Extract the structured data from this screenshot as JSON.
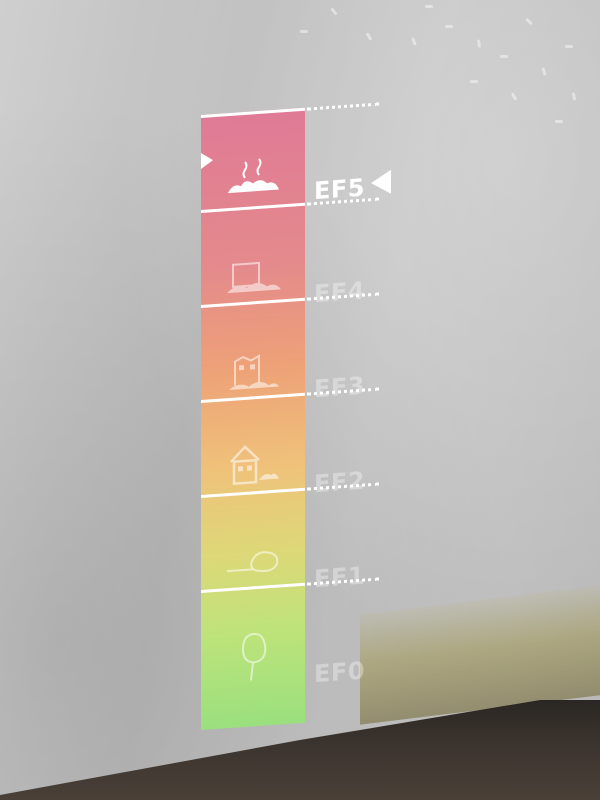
{
  "scale": {
    "levels": [
      {
        "label": "EF5",
        "icon": "destroyed-rubble-icon",
        "active": true
      },
      {
        "label": "EF4",
        "icon": "collapsed-house-icon",
        "active": false
      },
      {
        "label": "EF3",
        "icon": "damaged-house-icon",
        "active": false
      },
      {
        "label": "EF2",
        "icon": "house-icon",
        "active": false
      },
      {
        "label": "EF1",
        "icon": "fallen-tree-icon",
        "active": false
      },
      {
        "label": "EF0",
        "icon": "tree-icon",
        "active": false
      }
    ],
    "colors": {
      "top": "#e07a96",
      "middle": "#eea277",
      "bottom": "#9ae07e"
    }
  }
}
